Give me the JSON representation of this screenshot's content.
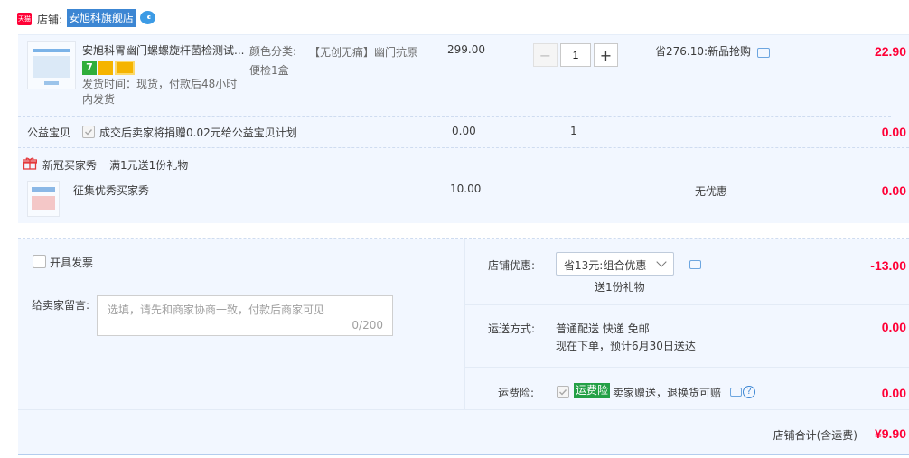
{
  "shop": {
    "badge": "天猫",
    "label": "店铺:",
    "name": "安旭科旗舰店"
  },
  "item": {
    "title": "安旭科胃幽门螺螺旋杆菌检测试...",
    "color_label": "颜色分类:",
    "color_value": "【无创无痛】幽门抗原便检1盒",
    "ship_time": "发货时间：现货，付款后48小时内发货",
    "price": "299.00",
    "qty": "1",
    "promo": "省276.10:新品抢购",
    "total": "22.90"
  },
  "charity": {
    "label": "公益宝贝",
    "text": "成交后卖家将捐赠0.02元给公益宝贝计划",
    "price": "0.00",
    "qty": "1",
    "total": "0.00"
  },
  "gift": {
    "title": "新冠买家秀",
    "desc": "满1元送1份礼物",
    "item_title": "征集优秀买家秀",
    "price": "10.00",
    "promo": "无优惠",
    "total": "0.00"
  },
  "invoice": {
    "label": "开具发票"
  },
  "message": {
    "label": "给卖家留言:",
    "placeholder": "选填，请先和商家协商一致，付款后商家可见",
    "counter": "0/200"
  },
  "discount": {
    "label": "店铺优惠:",
    "selected": "省13元:组合优惠",
    "sub": "送1份礼物",
    "amount": "-13.00"
  },
  "delivery": {
    "label": "运送方式:",
    "line1": "普通配送 快递 免邮",
    "line2": "现在下单，预计6月30日送达",
    "amount": "0.00"
  },
  "insurance": {
    "label": "运费险:",
    "tag": "运费险",
    "text": "卖家赠送，退换货可赔",
    "amount": "0.00"
  },
  "summary": {
    "label": "店铺合计(含运费)",
    "amount": "¥9.90"
  },
  "colors": {
    "accent_red": "#ff0036",
    "link_blue": "#3c86d3",
    "panel_bg": "#f2f7ff"
  }
}
